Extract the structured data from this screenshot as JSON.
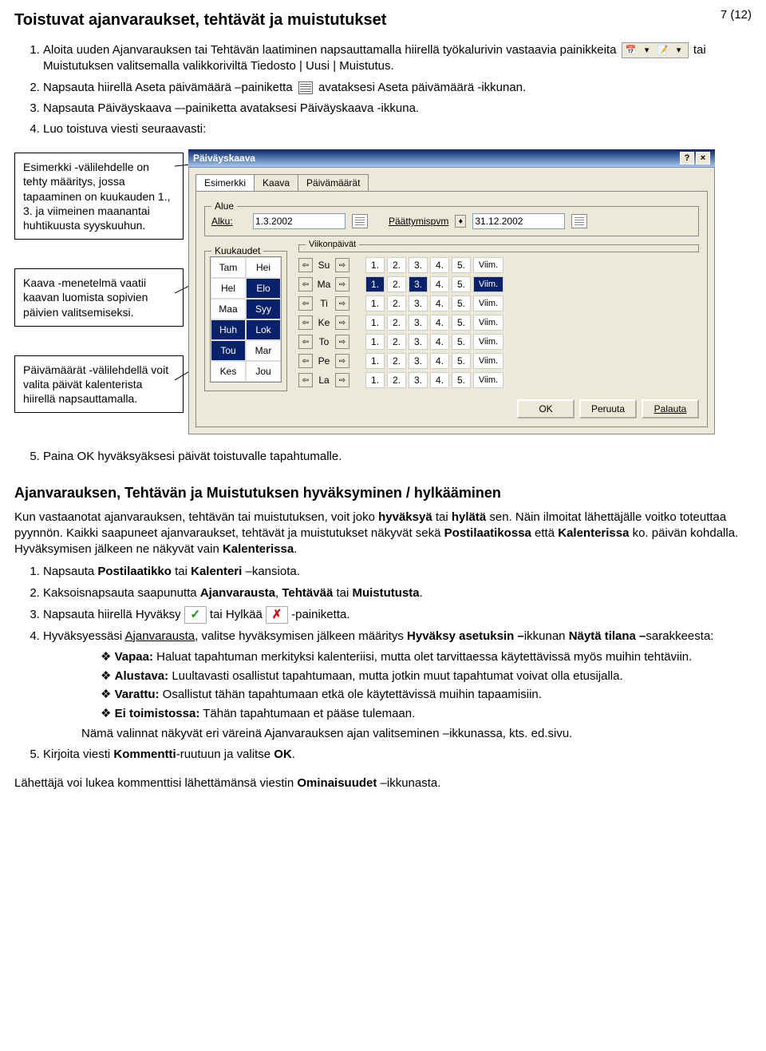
{
  "page_number": "7 (12)",
  "title": "Toistuvat ajanvaraukset, tehtävät ja muistutukset",
  "steps1": {
    "s1a": "Aloita uuden Ajanvarauksen tai Tehtävän laatiminen napsauttamalla hiirellä työkalurivin vastaavia painikkeita",
    "s1b": "tai Muistutuksen valitsemalla valikkoriviltä",
    "s1c": "Tiedosto | Uusi | Muistutus.",
    "s2a": "Napsauta hiirellä Aseta päivämäärä –painiketta",
    "s2b": "avataksesi Aseta päivämäärä -ikkunan.",
    "s3": "Napsauta Päiväyskaava –-painiketta avataksesi Päiväyskaava -ikkuna.",
    "s4": "Luo toistuva viesti seuraavasti:"
  },
  "callout1": "Esimerkki -välilehdelle on  tehty määritys, jossa tapaaminen on kuukauden 1., 3. ja viimeinen maanantai huhtikuusta syyskuuhun.",
  "callout2": "Kaava -menetelmä vaatii kaavan luomista sopivien päivien valitsemiseksi.",
  "callout3": "Päivämäärät -välilehdellä voit valita päivät kalenterista hiirellä napsauttamalla.",
  "dialog": {
    "title": "Päiväyskaava",
    "tabs": [
      "Esimerkki",
      "Kaava",
      "Päivämäärät"
    ],
    "group_alue": "Alue",
    "alku_label": "Alku:",
    "alku_value": "1.3.2002",
    "end_label": "Päättymispvm",
    "end_value": "31.12.2002",
    "group_kuukaudet": "Kuukaudet",
    "group_viikonpaivat": "Viikonpäivät",
    "months": [
      "Tam",
      "Hei",
      "Hel",
      "Elo",
      "Maa",
      "Syy",
      "Huh",
      "Lok",
      "Tou",
      "Mar",
      "Kes",
      "Jou"
    ],
    "month_selected": [
      3,
      5,
      6,
      7,
      8
    ],
    "days": [
      "Su",
      "Ma",
      "Ti",
      "Ke",
      "To",
      "Pe",
      "La"
    ],
    "numbers": [
      "1.",
      "2.",
      "3.",
      "4.",
      "5."
    ],
    "viim": "Viim.",
    "ma_sel": [
      0,
      2
    ],
    "ma_viim_sel": true,
    "buttons": {
      "ok": "OK",
      "cancel": "Peruuta",
      "reset": "Palauta"
    }
  },
  "step5": "Paina OK hyväksyäksesi päivät toistuvalle tapahtumalle.",
  "h2": "Ajanvarauksen, Tehtävän ja Muistutuksen hyväksyminen / hylkääminen",
  "para1": "Kun vastaanotat ajanvarauksen, tehtävän tai muistutuksen, voit joko hyväksyä tai hylätä sen. Näin ilmoitat lähettäjälle voitko toteuttaa pyynnön. Kaikki saapuneet ajanvaraukset, tehtävät ja muistutukset näkyvät sekä Postilaatikossa että Kalenterissa ko. päivän kohdalla. Hyväksymisen jälkeen ne näkyvät vain Kalenterissa.",
  "steps2": {
    "s1": "Napsauta Postilaatikko tai Kalenteri –kansiota.",
    "s2": "Kaksoisnapsauta saapunutta Ajanvarausta, Tehtävää tai Muistutusta.",
    "s3a": "Napsauta hiirellä Hyväksy",
    "s3b": "tai Hylkää",
    "s3c": "-painiketta.",
    "s4a": "Hyväksyessäsi ",
    "s4b": "Ajanvarausta",
    "s4c": ", valitse hyväksymisen jälkeen määritys Hyväksy asetuksin –ikkunan Näytä tilana –sarakkeesta:"
  },
  "bullets": {
    "b1a": "Vapaa:",
    "b1b": "Haluat tapahtuman merkityksi kalenteriisi, mutta olet tarvittaessa käytettävissä myös muihin tehtäviin.",
    "b2a": "Alustava:",
    "b2b": "Luultavasti osallistut tapahtumaan, mutta jotkin muut tapahtumat voivat olla etusijalla.",
    "b3a": "Varattu:",
    "b3b": "Osallistut tähän tapahtumaan etkä ole käytettävissä muihin tapaamisiin.",
    "b4a": "Ei toimistossa:",
    "b4b": "Tähän tapahtumaan et pääse tulemaan.",
    "b5": "Nämä valinnat näkyvät eri väreinä Ajanvarauksen ajan valitseminen –ikkunassa, kts. ed.sivu."
  },
  "step5b": "Kirjoita viesti Kommentti-ruutuun ja valitse OK.",
  "footer": "Lähettäjä voi lukea kommenttisi lähettämänsä viestin Ominaisuudet –ikkunasta."
}
